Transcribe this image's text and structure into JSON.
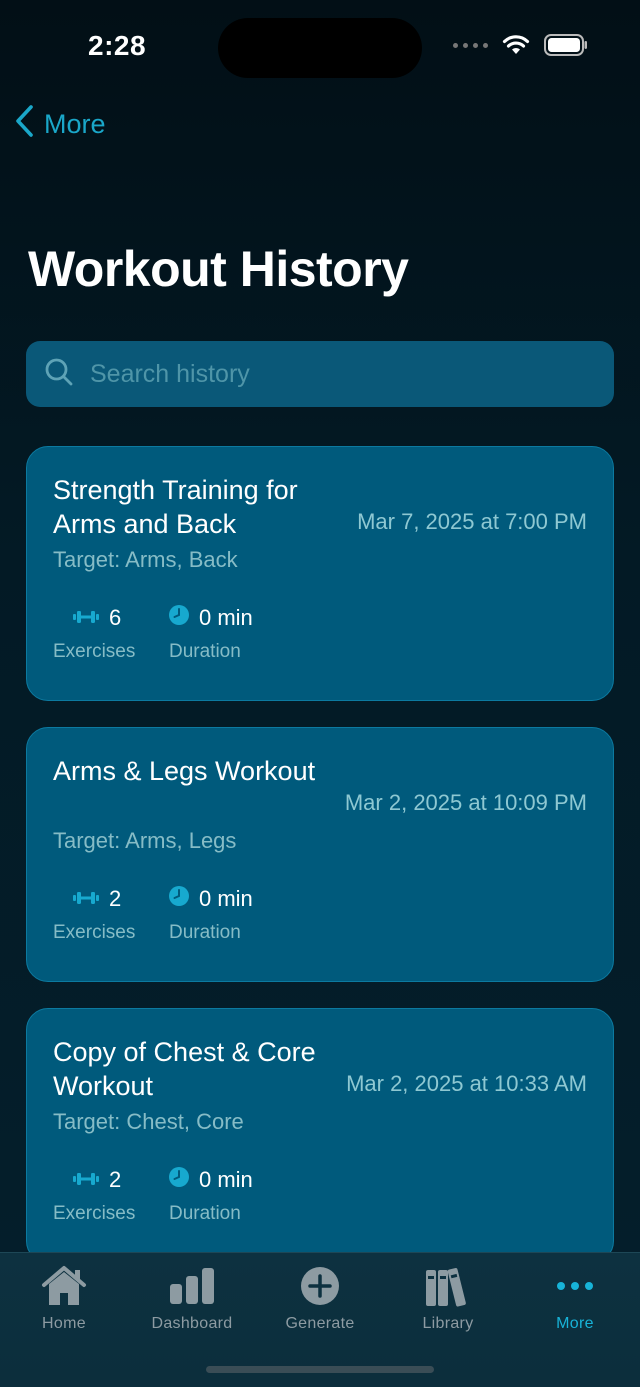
{
  "status_bar": {
    "time": "2:28"
  },
  "nav": {
    "back_label": "More"
  },
  "page_title": "Workout History",
  "search": {
    "placeholder": "Search history",
    "value": ""
  },
  "colors": {
    "accent": "#17b3d8",
    "card_bg": "#005a7c",
    "background": "#031720"
  },
  "workouts": [
    {
      "title": "Strength Training for Arms and Back",
      "date": "Mar 7, 2025 at 7:00 PM",
      "target": "Target: Arms, Back",
      "exercises_count": "6",
      "exercises_label": "Exercises",
      "duration": "0 min",
      "duration_label": "Duration"
    },
    {
      "title": "Arms & Legs Workout",
      "date": "Mar 2, 2025 at 10:09 PM",
      "target": "Target: Arms, Legs",
      "exercises_count": "2",
      "exercises_label": "Exercises",
      "duration": "0 min",
      "duration_label": "Duration"
    },
    {
      "title": "Copy of Chest & Core Workout",
      "date": "Mar 2, 2025 at 10:33 AM",
      "target": "Target: Chest, Core",
      "exercises_count": "2",
      "exercises_label": "Exercises",
      "duration": "0 min",
      "duration_label": "Duration"
    }
  ],
  "tabs": [
    {
      "label": "Home",
      "icon": "house-icon",
      "active": false
    },
    {
      "label": "Dashboard",
      "icon": "bar-chart-icon",
      "active": false
    },
    {
      "label": "Generate",
      "icon": "plus-circle-icon",
      "active": false
    },
    {
      "label": "Library",
      "icon": "books-icon",
      "active": false
    },
    {
      "label": "More",
      "icon": "ellipsis-icon",
      "active": true
    }
  ]
}
